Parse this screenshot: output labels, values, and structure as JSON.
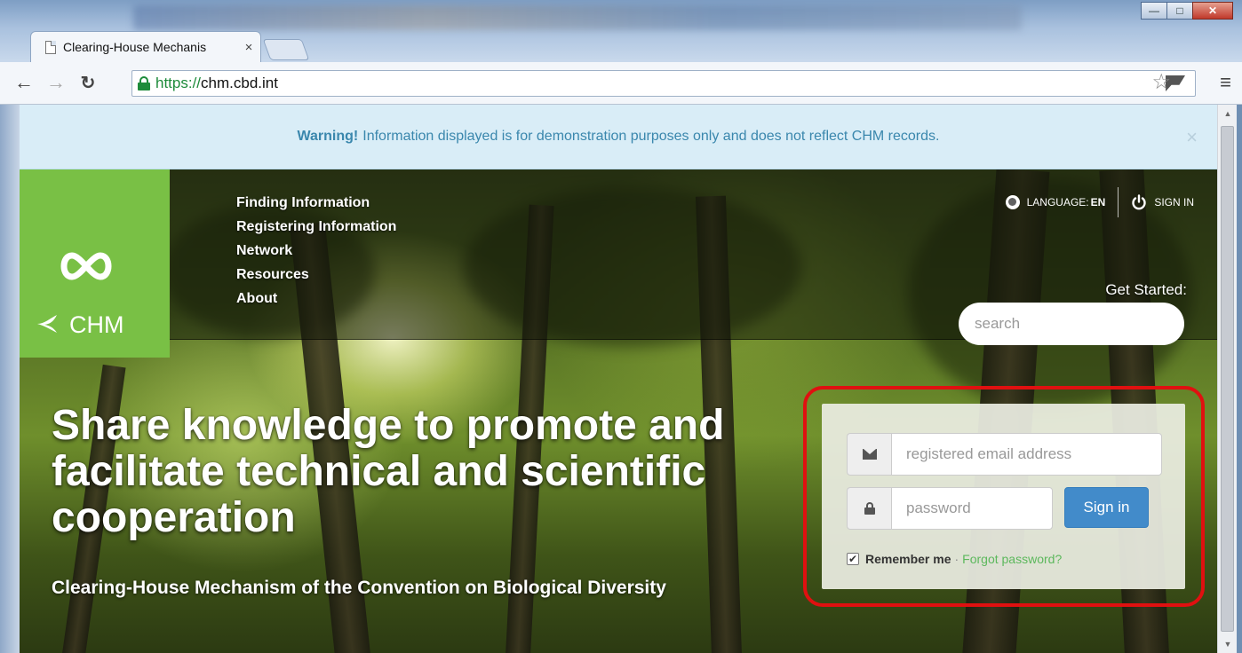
{
  "browser": {
    "tab_title": "Clearing-House Mechanis",
    "tab_close": "×",
    "url_scheme": "https://",
    "url_rest": "chm.cbd.int",
    "window_controls": [
      "minimize",
      "maximize",
      "close"
    ]
  },
  "warning": {
    "label": "Warning!",
    "text": "Information displayed is for demonstration purposes only and does not reflect CHM records.",
    "close": "×"
  },
  "logo": {
    "text": "CHM"
  },
  "nav": {
    "items": [
      "Finding Information",
      "Registering Information",
      "Network",
      "Resources",
      "About"
    ]
  },
  "topbar": {
    "language_label": "LANGUAGE:",
    "language_value": "EN",
    "signin": "SIGN IN"
  },
  "search": {
    "heading": "Get Started:",
    "placeholder": "search"
  },
  "hero": {
    "headline": "Share knowledge to promote and facilitate technical and scientific cooperation",
    "subheadline": "Clearing-House Mechanism of the Convention on Biological Diversity"
  },
  "login": {
    "email_placeholder": "registered email address",
    "password_placeholder": "password",
    "signin_button": "Sign in",
    "remember_label": "Remember me",
    "separator": "·",
    "forgot_link": "Forgot password?",
    "remember_checked": true
  },
  "colors": {
    "logo_green": "#79c045",
    "warning_bg": "#d9edf7",
    "warning_text": "#3a87ad",
    "button_blue": "#428bca",
    "link_green": "#5cb85c",
    "highlight_red": "#e01010"
  }
}
